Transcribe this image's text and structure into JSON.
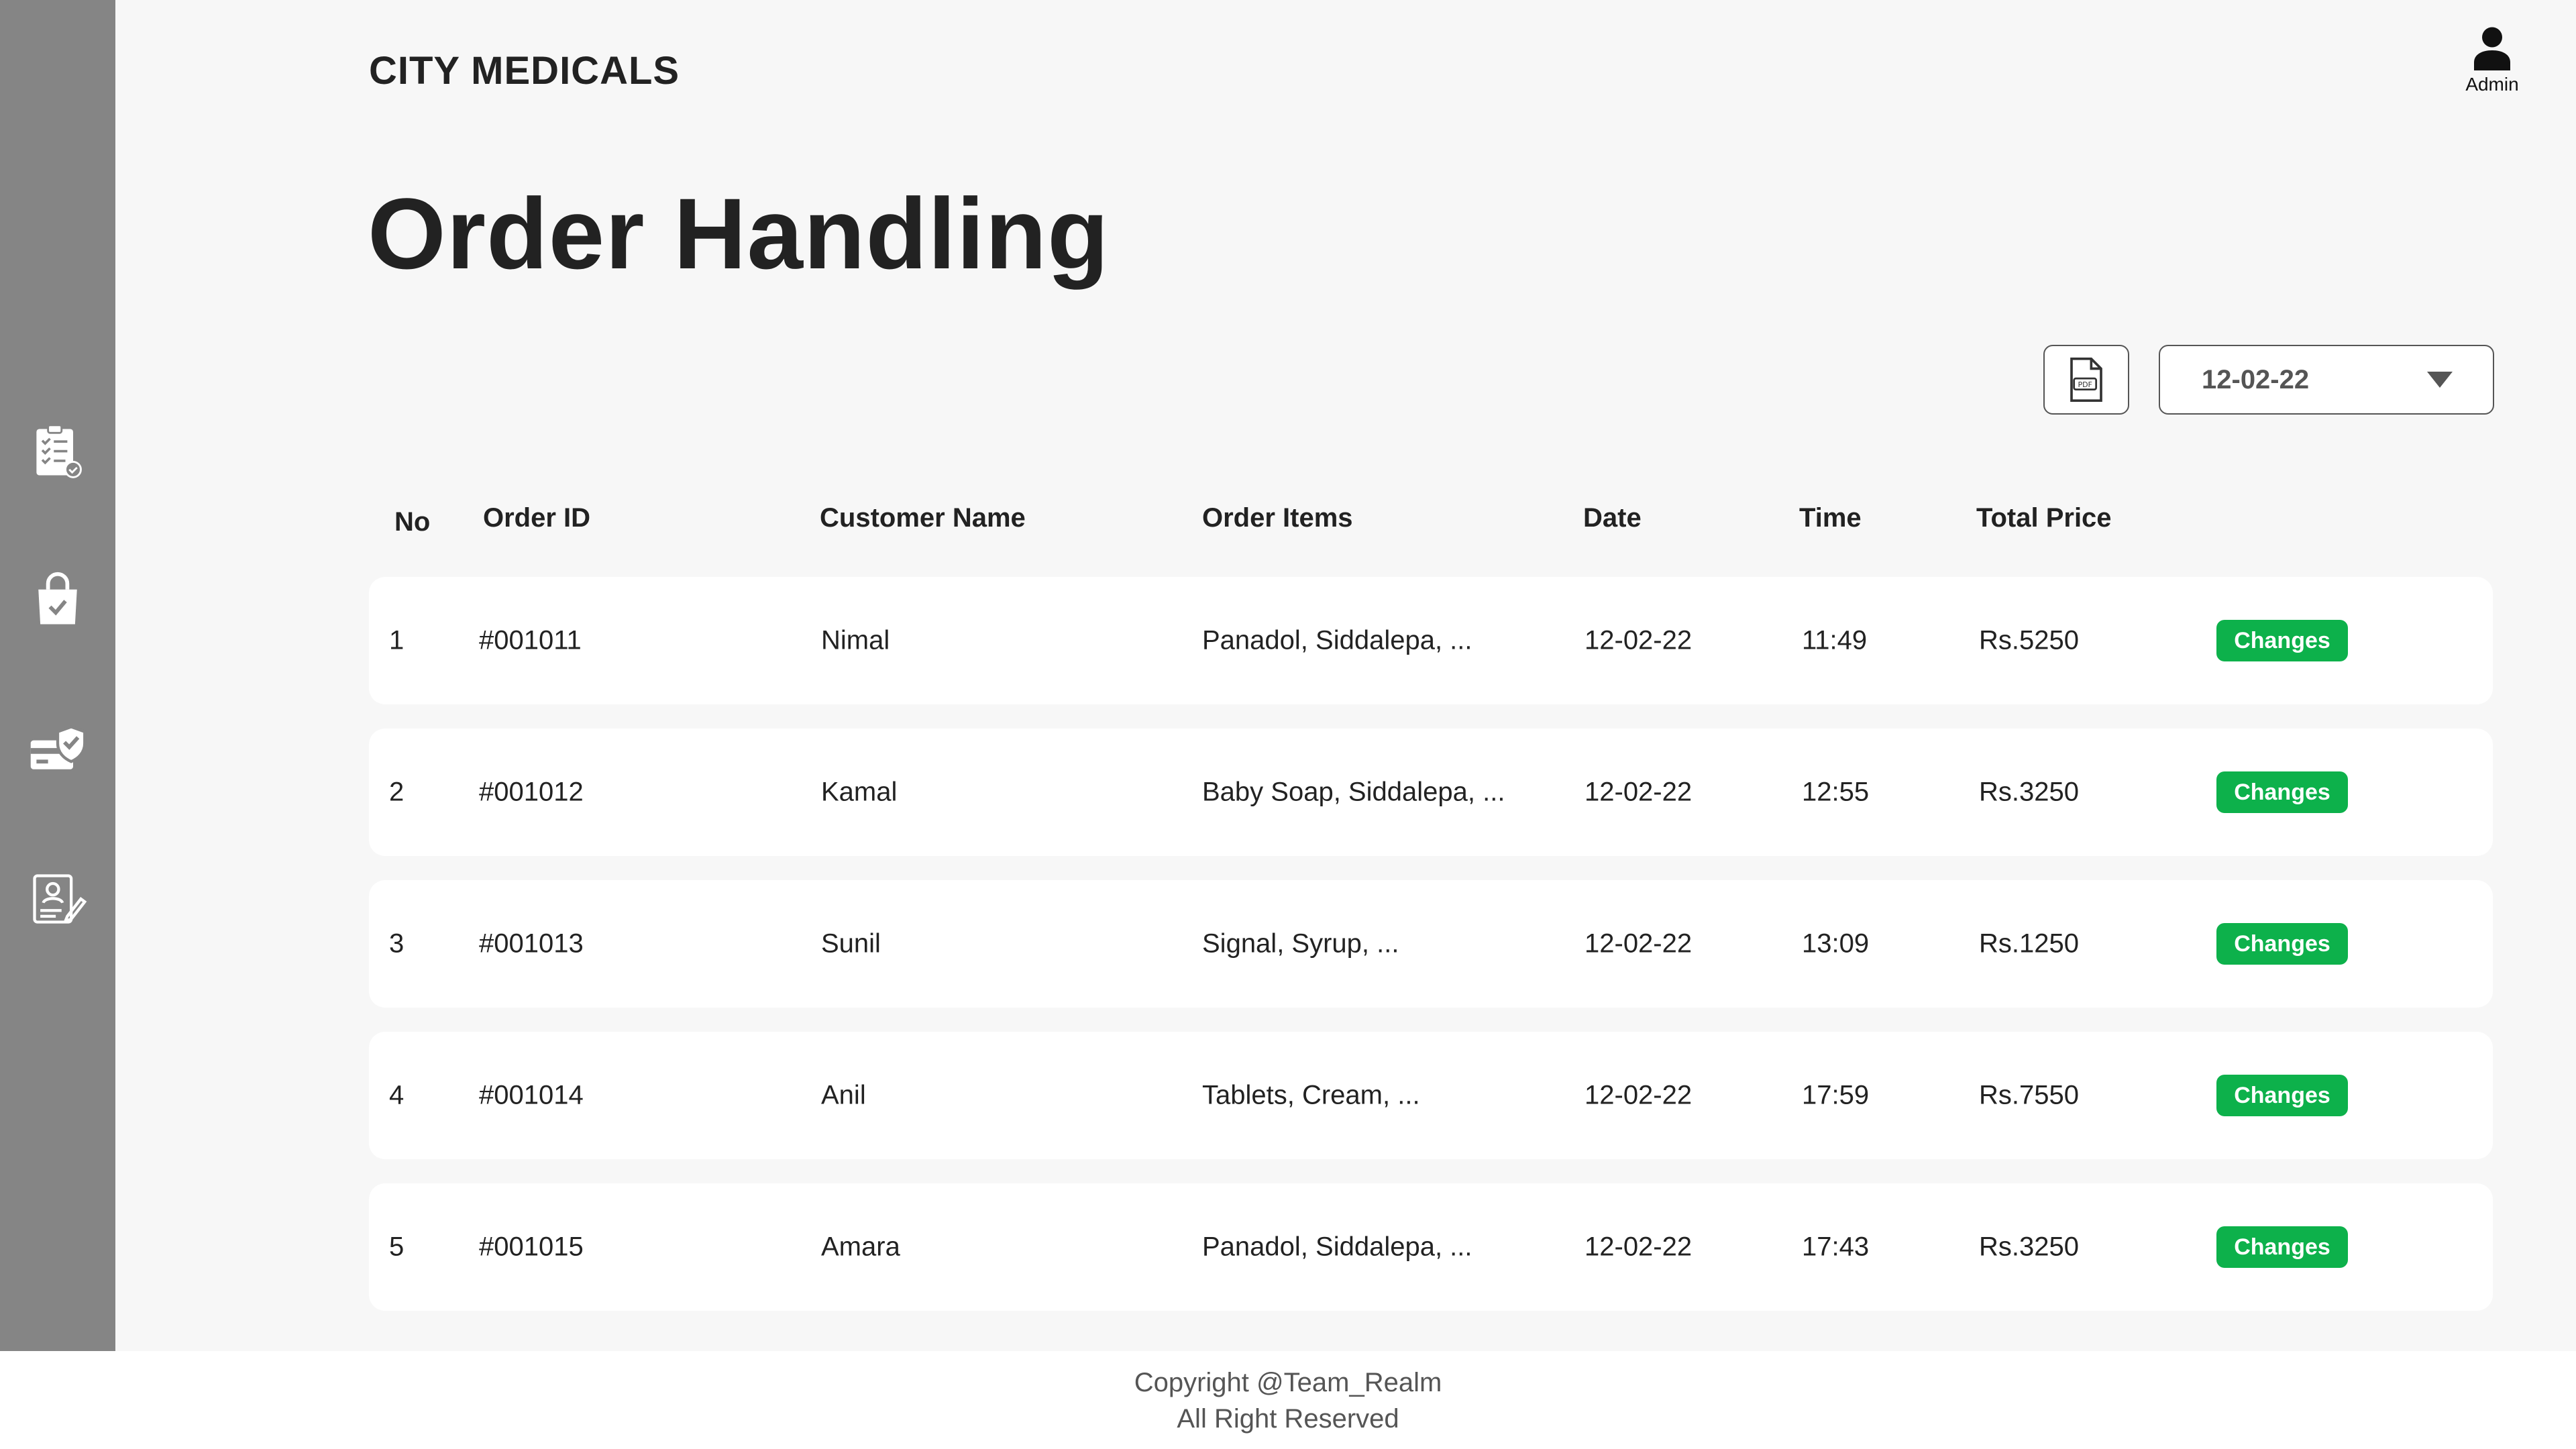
{
  "brand": "CITY MEDICALS",
  "admin": {
    "label": "Admin",
    "icon": "user-icon"
  },
  "page_title": "Order Handling",
  "sidebar": {
    "items": [
      {
        "icon": "clipboard-checklist-icon"
      },
      {
        "icon": "shopping-bag-check-icon"
      },
      {
        "icon": "card-shield-check-icon"
      },
      {
        "icon": "profile-document-edit-icon"
      }
    ]
  },
  "toolbar": {
    "pdf_icon": "pdf-file-icon",
    "date_value": "12-02-22"
  },
  "table": {
    "columns": [
      "No",
      "Order ID",
      "Customer Name",
      "Order Items",
      "Date",
      "Time",
      "Total Price"
    ],
    "rows": [
      {
        "no": "1",
        "order_id": "#001011",
        "customer": "Nimal",
        "items": "Panadol, Siddalepa, ...",
        "date": "12-02-22",
        "time": "11:49",
        "total": "Rs.5250",
        "action": "Changes"
      },
      {
        "no": "2",
        "order_id": "#001012",
        "customer": "Kamal",
        "items": "Baby Soap, Siddalepa, ...",
        "date": "12-02-22",
        "time": "12:55",
        "total": "Rs.3250",
        "action": "Changes"
      },
      {
        "no": "3",
        "order_id": "#001013",
        "customer": "Sunil",
        "items": "Signal, Syrup, ...",
        "date": "12-02-22",
        "time": "13:09",
        "total": "Rs.1250",
        "action": "Changes"
      },
      {
        "no": "4",
        "order_id": "#001014",
        "customer": "Anil",
        "items": "Tablets, Cream, ...",
        "date": "12-02-22",
        "time": "17:59",
        "total": "Rs.7550",
        "action": "Changes"
      },
      {
        "no": "5",
        "order_id": "#001015",
        "customer": "Amara",
        "items": "Panadol, Siddalepa, ...",
        "date": "12-02-22",
        "time": "17:43",
        "total": "Rs.3250",
        "action": "Changes"
      }
    ]
  },
  "footer": {
    "line1": "Copyright @Team_Realm",
    "line2": "All Right Reserved"
  },
  "colors": {
    "sidebar_bg": "#858585",
    "page_bg": "#f7f7f7",
    "accent_green": "#0db14b"
  }
}
